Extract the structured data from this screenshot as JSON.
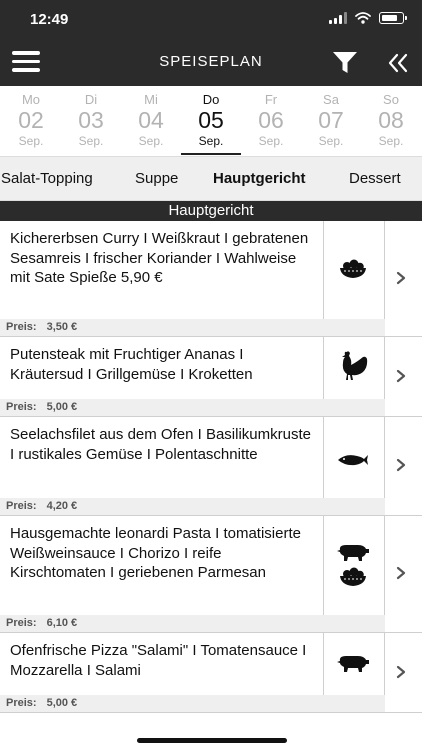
{
  "status_bar": {
    "time": "12:49"
  },
  "header": {
    "title": "SPEISEPLAN"
  },
  "days": [
    {
      "weekday": "Mo",
      "day": "02",
      "month": "Sep.",
      "active": false
    },
    {
      "weekday": "Di",
      "day": "03",
      "month": "Sep.",
      "active": false
    },
    {
      "weekday": "Mi",
      "day": "04",
      "month": "Sep.",
      "active": false
    },
    {
      "weekday": "Do",
      "day": "05",
      "month": "Sep.",
      "active": true
    },
    {
      "weekday": "Fr",
      "day": "06",
      "month": "Sep.",
      "active": false
    },
    {
      "weekday": "Sa",
      "day": "07",
      "month": "Sep.",
      "active": false
    },
    {
      "weekday": "So",
      "day": "08",
      "month": "Sep.",
      "active": false
    }
  ],
  "categories": [
    {
      "label": "Salat-Topping",
      "active": false
    },
    {
      "label": "Suppe",
      "active": false
    },
    {
      "label": "Hauptgericht",
      "active": true
    },
    {
      "label": "Dessert",
      "active": false
    }
  ],
  "section_title": "Hauptgericht",
  "price_label": "Preis:",
  "dishes": [
    {
      "description": "Kichererbsen Curry I Weißkraut I gebratenen Sesamreis I frischer Koriander I Wahlweise mit Sate Spieße 5,90 €",
      "price": "3,50 €",
      "icons": [
        "vegetarian-bowl-icon"
      ]
    },
    {
      "description": "Putensteak mit Fruchtiger Ananas I Kräutersud I Grillgemüse I Kroketten",
      "price": "5,00 €",
      "icons": [
        "poultry-icon"
      ]
    },
    {
      "description": "Seelachsfilet aus dem Ofen I Basilikumkruste I rustikales Gemüse I Polentaschnitte",
      "price": "4,20 €",
      "icons": [
        "fish-icon"
      ]
    },
    {
      "description": "Hausgemachte leonardi Pasta I tomatisierte Weißweinsauce I Chorizo I reife Kirschtomaten I geriebenen Parmesan",
      "price": "6,10 €",
      "icons": [
        "pork-icon",
        "vegetarian-bowl-icon"
      ]
    },
    {
      "description": "Ofenfrische Pizza \"Salami\" I Tomatensauce I Mozzarella I Salami",
      "price": "5,00 €",
      "icons": [
        "pork-icon"
      ]
    }
  ]
}
